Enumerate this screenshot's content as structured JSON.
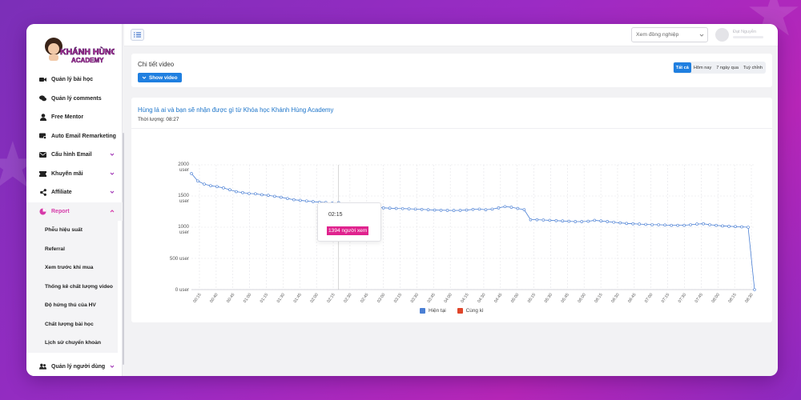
{
  "brand": {
    "logo_line1": "KHÁNH HÙNG",
    "logo_line2": "ACADEMY"
  },
  "sidebar": {
    "items": [
      {
        "label": "Quản lý bài học",
        "icon": "video-camera-icon"
      },
      {
        "label": "Quản lý comments",
        "icon": "comments-icon"
      },
      {
        "label": "Free Mentor",
        "icon": "user-icon"
      },
      {
        "label": "Auto Email Remarketing",
        "icon": "email-settings-icon"
      },
      {
        "label": "Cấu hình Email",
        "icon": "envelope-icon",
        "expandable": true
      },
      {
        "label": "Khuyến mãi",
        "icon": "ticket-icon",
        "expandable": true
      },
      {
        "label": "Affiliate",
        "icon": "share-icon",
        "expandable": true
      },
      {
        "label": "Report",
        "icon": "pie-chart-icon",
        "expandable": true,
        "active": true
      }
    ],
    "report_sub_items": [
      "Phễu hiệu suất",
      "Referral",
      "Xem trước khi mua",
      "Thống kê chất lượng video",
      "Độ hứng thú của HV",
      "Chất lượng bài học",
      "Lịch sử chuyển khoản"
    ],
    "bottom_item": {
      "label": "Quản lý người dùng",
      "icon": "users-icon",
      "expandable": true
    }
  },
  "header": {
    "search_placeholder": "Xem đồng nghiệp",
    "user_name": "Đạt Nguyễn"
  },
  "video_section": {
    "title": "Chi tiết video",
    "show_button": "Show video",
    "tabs": [
      "Tất cả",
      "Hôm nay",
      "7 ngày qua",
      "Tuỳ chỉnh"
    ],
    "active_tab": "Tất cả"
  },
  "chart_card": {
    "video_title": "Hùng lá ai và bạn sẽ nhận được gì từ Khóa học Khánh Hùng Academy",
    "duration": "Thời lượng: 08:27"
  },
  "tooltip": {
    "time": "02:15",
    "value_label": "1394 người xem"
  },
  "colors": {
    "accent": "#1f7fe0",
    "brand": "#d63aa9",
    "series_current": "#4a7fd4",
    "series_previous": "#e0452a",
    "tooltip_badge": "#e0238e"
  },
  "chart_data": {
    "type": "line",
    "ylim": [
      0,
      2000
    ],
    "y_ticks": [
      {
        "value": 2000,
        "label": "2000",
        "sub": "user"
      },
      {
        "value": 1500,
        "label": "1500",
        "sub": "user"
      },
      {
        "value": 1000,
        "label": "1000",
        "sub": "user"
      },
      {
        "value": 500,
        "label": "500 user",
        "sub": ""
      },
      {
        "value": 0,
        "label": "0 user",
        "sub": ""
      }
    ],
    "x_tick_labels": [
      "00:15",
      "00:40",
      "00:45",
      "01:00",
      "01:15",
      "01:30",
      "01:45",
      "02:00",
      "02:15",
      "02:30",
      "02:45",
      "03:00",
      "03:15",
      "03:30",
      "03:45",
      "04:00",
      "04:15",
      "04:30",
      "04:45",
      "05:00",
      "05:15",
      "05:30",
      "05:45",
      "06:00",
      "06:15",
      "06:30",
      "06:45",
      "07:00",
      "07:15",
      "07:30",
      "07:45",
      "08:00",
      "08:15",
      "08:30"
    ],
    "legend": [
      "Hiện tại",
      "Cùng kì"
    ],
    "series": [
      {
        "name": "Hiện tại",
        "values": [
          1860,
          1740,
          1690,
          1665,
          1650,
          1630,
          1600,
          1570,
          1555,
          1540,
          1535,
          1520,
          1510,
          1495,
          1480,
          1460,
          1440,
          1430,
          1420,
          1410,
          1400,
          1395,
          1385,
          1394,
          1375,
          1360,
          1350,
          1340,
          1330,
          1320,
          1310,
          1305,
          1300,
          1298,
          1295,
          1290,
          1285,
          1280,
          1275,
          1272,
          1270,
          1268,
          1270,
          1275,
          1285,
          1290,
          1280,
          1290,
          1310,
          1330,
          1320,
          1300,
          1280,
          1120,
          1120,
          1115,
          1110,
          1105,
          1100,
          1095,
          1090,
          1090,
          1095,
          1110,
          1100,
          1090,
          1080,
          1070,
          1060,
          1055,
          1050,
          1045,
          1040,
          1040,
          1035,
          1030,
          1030,
          1030,
          1040,
          1050,
          1055,
          1040,
          1030,
          1020,
          1015,
          1010,
          1005,
          1000,
          0
        ]
      }
    ]
  }
}
